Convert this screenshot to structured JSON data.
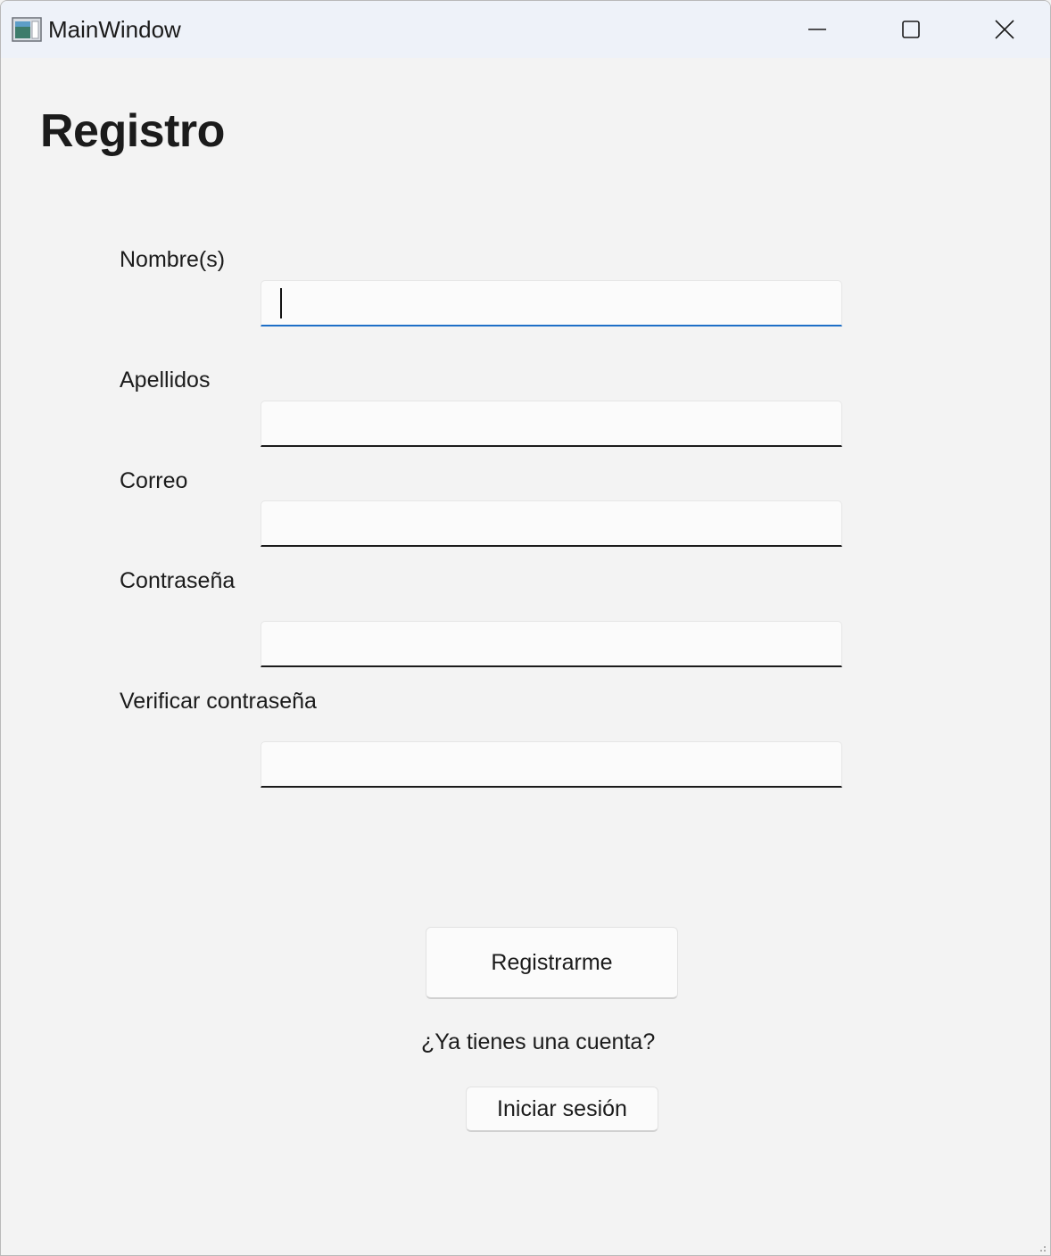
{
  "window": {
    "title": "MainWindow",
    "app_icon": "app-window-icon",
    "controls": [
      "minimize-icon",
      "maximize-icon",
      "close-icon"
    ]
  },
  "form": {
    "heading": "Registro",
    "fields": [
      {
        "label": "Nombre(s)",
        "value": "",
        "focused": true
      },
      {
        "label": "Apellidos",
        "value": ""
      },
      {
        "label": "Correo",
        "value": ""
      },
      {
        "label": "Contraseña",
        "value": ""
      },
      {
        "label": "Verificar contraseña",
        "value": ""
      }
    ],
    "register_button": "Registrarme",
    "login_prompt": "¿Ya tienes una cuenta?",
    "login_button": "Iniciar sesión"
  },
  "colors": {
    "background": "#f3f3f3",
    "titlebar": "#eef2f9",
    "focus_accent": "#1e6fc7",
    "text": "#1b1b1b"
  }
}
